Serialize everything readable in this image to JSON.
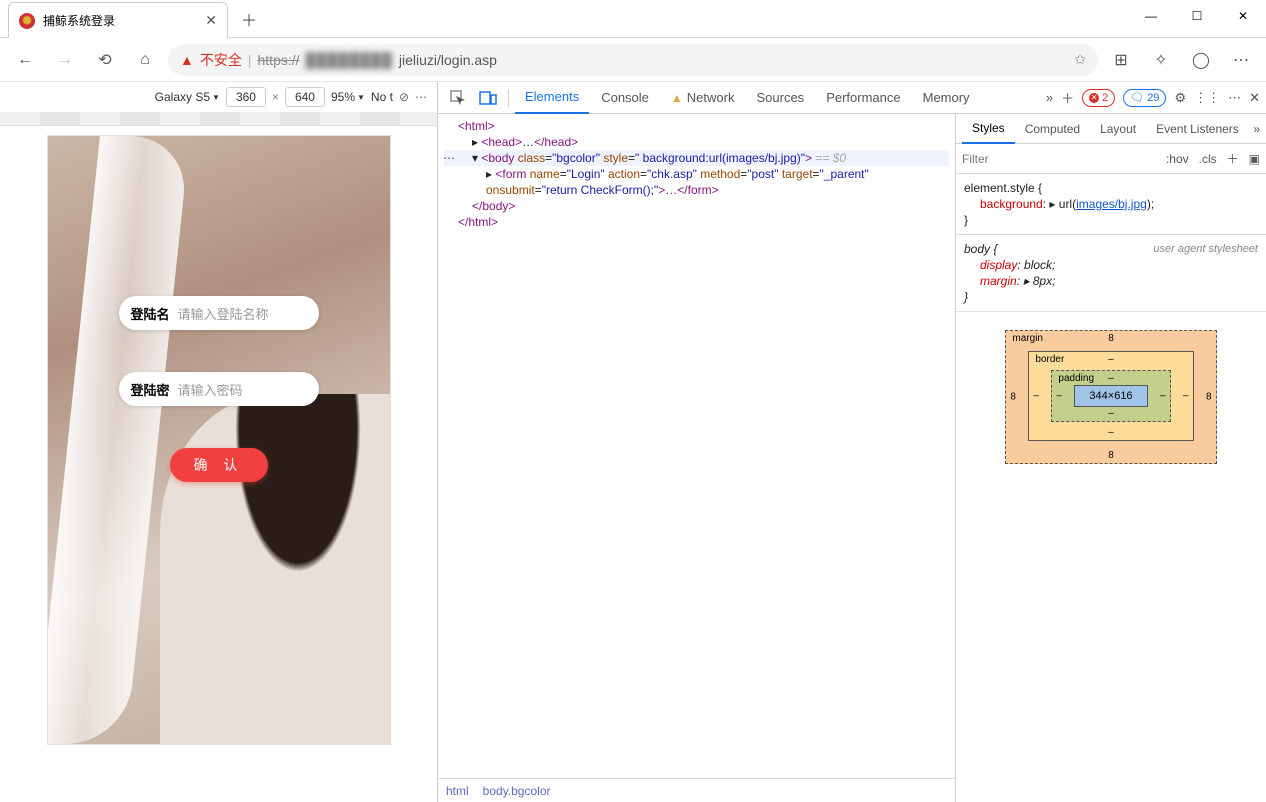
{
  "window": {
    "tab_title": "捕鲸系统登录"
  },
  "addr": {
    "insecure": "不安全",
    "https": "https://",
    "blur": "████████",
    "rest": "jieliuzi/login.asp"
  },
  "device_toolbar": {
    "device": "Galaxy S5",
    "width": "360",
    "height": "640",
    "zoom": "95%",
    "throttle": "No t"
  },
  "login": {
    "name_label": "登陆名",
    "name_ph": "请输入登陆名称",
    "pass_label": "登陆密",
    "pass_ph": "请输入密码",
    "confirm": "确 认"
  },
  "devtools": {
    "tabs": {
      "elements": "Elements",
      "console": "Console",
      "network": "Network",
      "sources": "Sources",
      "performance": "Performance",
      "memory": "Memory"
    },
    "errors": "2",
    "issues": "29"
  },
  "dom": {
    "l1": "<html>",
    "l2_a": "<head>",
    "l2_b": "…",
    "l2_c": "</head>",
    "l3_pre": "▾",
    "l3_a": "<body ",
    "l3_attr1n": "class",
    "l3_attr1v": "\"bgcolor\"",
    "l3_attr2n": "style",
    "l3_attr2v": "\" background:url(images/bj.jpg)\"",
    "l3_end": ">",
    "l3_sel": "== $0",
    "l4_a": "<form ",
    "l4_1n": "name",
    "l4_1v": "\"Login\"",
    "l4_2n": "action",
    "l4_2v": "\"chk.asp\"",
    "l4_3n": "method",
    "l4_3v": "\"post\"",
    "l4_4n": "target",
    "l4_4v": "\"_parent\"",
    "l5_1n": "onsubmit",
    "l5_1v": "\"return CheckForm();\"",
    "l5_mid": ">…",
    "l5_end": "</form>",
    "l6": "</body>",
    "l7": "</html>"
  },
  "crumbs": {
    "c1": "html",
    "c2": "body.bgcolor"
  },
  "styles": {
    "tabs": {
      "styles": "Styles",
      "computed": "Computed",
      "layout": "Layout",
      "listeners": "Event Listeners"
    },
    "filter_ph": "Filter",
    "hov": ":hov",
    "cls": ".cls",
    "rule1": {
      "sel": "element.style {",
      "prop_n": "background",
      "prop_arrow": "▸",
      "prop_fn": "url(",
      "prop_link": "images/bj.jpg",
      "prop_close": ");",
      "end": "}"
    },
    "rule2": {
      "sel": "body {",
      "ua": "user agent stylesheet",
      "p1n": "display",
      "p1v": "block;",
      "p2n": "margin",
      "p2arrow": "▸",
      "p2v": "8px;",
      "end": "}"
    },
    "box": {
      "margin": "margin",
      "border": "border",
      "padding": "padding",
      "m": "8",
      "dash": "–",
      "content": "344×616"
    }
  }
}
